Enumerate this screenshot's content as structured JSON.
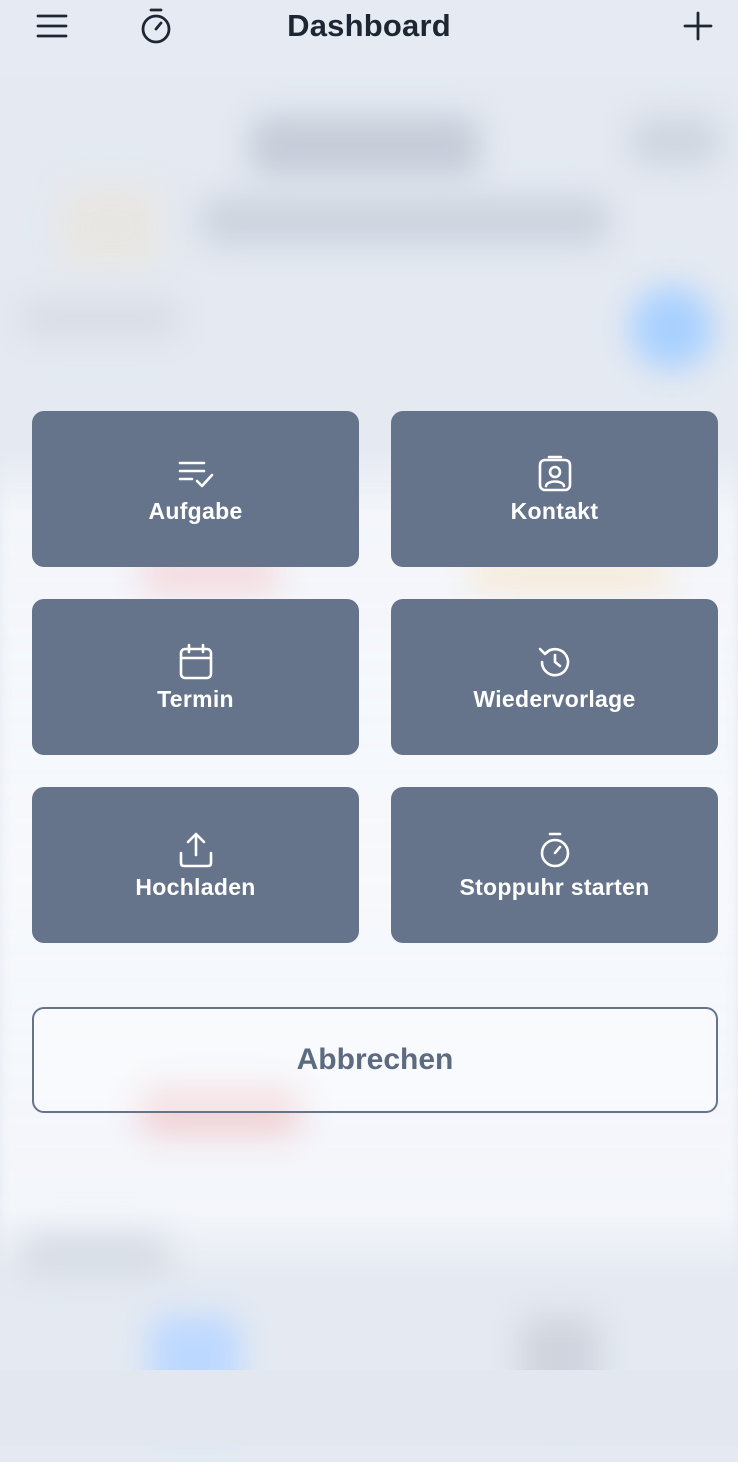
{
  "header": {
    "title": "Dashboard",
    "menu_icon": "menu-icon",
    "timer_icon": "stopwatch-icon",
    "add_icon": "plus-icon"
  },
  "actions": [
    {
      "label": "Aufgabe",
      "icon": "task-list-icon"
    },
    {
      "label": "Kontakt",
      "icon": "contact-card-icon"
    },
    {
      "label": "Termin",
      "icon": "calendar-icon"
    },
    {
      "label": "Wiedervorlage",
      "icon": "history-icon"
    },
    {
      "label": "Hochladen",
      "icon": "upload-icon"
    },
    {
      "label": "Stoppuhr starten",
      "icon": "stopwatch-icon"
    }
  ],
  "cancel_label": "Abbrechen",
  "colors": {
    "tile_background": "#65748a",
    "tile_text": "#ffffff",
    "backdrop": "#e5eaf2",
    "header_text": "#1f2633"
  }
}
